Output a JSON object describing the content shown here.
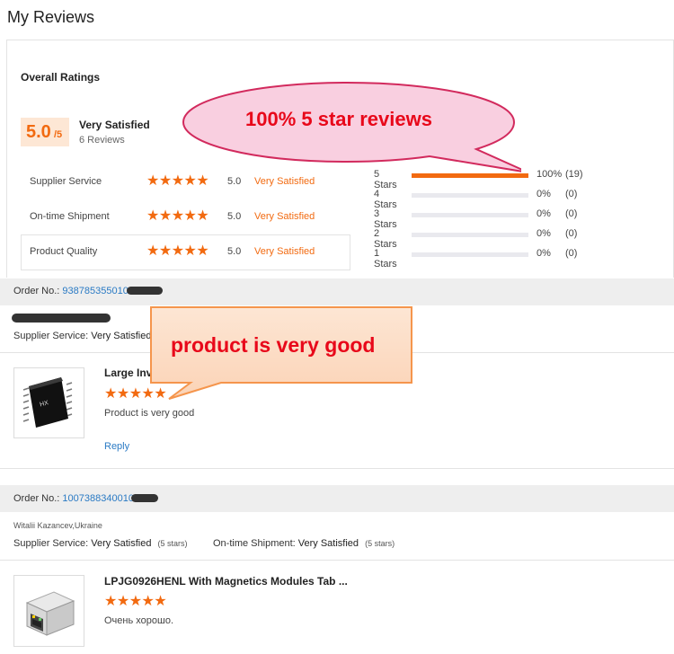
{
  "page": {
    "title": "My Reviews"
  },
  "overall": {
    "title": "Overall Ratings",
    "score": "5.0",
    "score_suffix": "/5",
    "label": "Very Satisfied",
    "count": "6 Reviews"
  },
  "ratings": [
    {
      "label": "Supplier Service",
      "stars": "★★★★★",
      "value": "5.0",
      "text": "Very Satisfied"
    },
    {
      "label": "On-time Shipment",
      "stars": "★★★★★",
      "value": "5.0",
      "text": "Very Satisfied"
    },
    {
      "label": "Product Quality",
      "stars": "★★★★★",
      "value": "5.0",
      "text": "Very Satisfied"
    }
  ],
  "distribution": [
    {
      "label": "5 Stars",
      "fraction": 1.0,
      "pct": "100%",
      "count": "(19)"
    },
    {
      "label": "4 Stars",
      "fraction": 0.0,
      "pct": "0%",
      "count": "(0)"
    },
    {
      "label": "3 Stars",
      "fraction": 0.0,
      "pct": "0%",
      "count": "(0)"
    },
    {
      "label": "2 Stars",
      "fraction": 0.0,
      "pct": "0%",
      "count": "(0)"
    },
    {
      "label": "1 Stars",
      "fraction": 0.0,
      "pct": "0%",
      "count": "(0)"
    }
  ],
  "orders": [
    {
      "order_label": "Order No.:",
      "order_number": "938785355010",
      "supplier_label": "Supplier Service:",
      "supplier_value": "Very Satisfied",
      "product_title": "Large Inv",
      "stars": "★★★★★",
      "review": "Product is very good",
      "reply": "Reply"
    },
    {
      "order_label": "Order No.:",
      "order_number": "1007388340010",
      "reviewer": "Witalii Kazancev,Ukraine",
      "supplier_label": "Supplier Service:",
      "supplier_value": "Very Satisfied",
      "supplier_stars": "(5 stars)",
      "shipment_label": "On-time Shipment:",
      "shipment_value": "Very Satisfied",
      "shipment_stars": "(5 stars)",
      "product_title": "LPJG0926HENL With Magnetics Modules Tab ...",
      "stars": "★★★★★",
      "review": "Очень хорошо."
    }
  ],
  "callouts": {
    "top": "100% 5 star reviews",
    "middle": "product is very good"
  },
  "colors": {
    "accent": "#f26a10",
    "link": "#2a7ac4",
    "callout_text": "#e8081a"
  }
}
